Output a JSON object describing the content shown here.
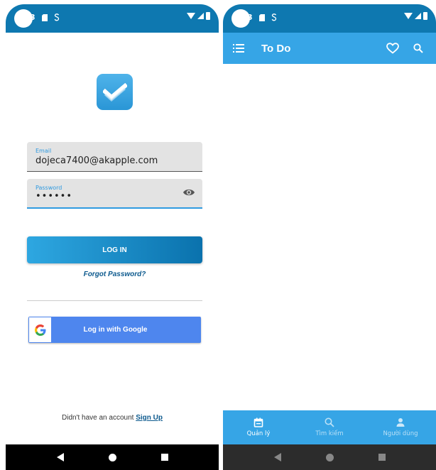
{
  "status_bar": {
    "time": "3",
    "icons": [
      "sd-card-icon",
      "s-icon",
      "wifi-icon",
      "signal-icon",
      "battery-icon"
    ]
  },
  "login": {
    "email_label": "Email",
    "email_value": "dojeca7400@akapple.com",
    "password_label": "Password",
    "password_value": "••••••",
    "login_button": "LOG IN",
    "forgot_password": "Forgot Password?",
    "google_button": "Log in with Google",
    "google_letter": "G",
    "signup_prompt": "Didn't have an account",
    "signup_link": "Sign Up"
  },
  "todo": {
    "title": "To Do",
    "bottom_nav": [
      {
        "label": "Quản lý",
        "icon": "calendar-icon",
        "active": true
      },
      {
        "label": "Tìm kiếm",
        "icon": "search-icon",
        "active": false
      },
      {
        "label": "Người dùng",
        "icon": "person-icon",
        "active": false
      }
    ]
  },
  "colors": {
    "accent": "#36a5e6",
    "status_bar": "#0e78b0",
    "login_gradient_start": "#2ea7e1",
    "login_gradient_end": "#0a72ad",
    "google_blue": "#4e86ee",
    "link": "#0d5a8e"
  }
}
